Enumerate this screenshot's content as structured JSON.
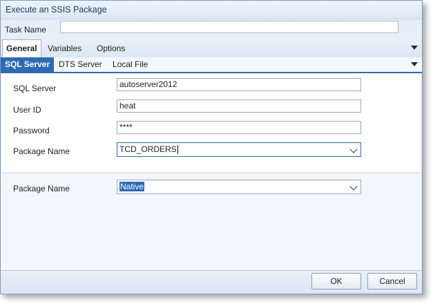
{
  "window": {
    "title": "Execute an SSIS Package"
  },
  "task": {
    "label": "Task Name",
    "value": ""
  },
  "tabs_primary": [
    {
      "label": "General",
      "active": true
    },
    {
      "label": "Variables",
      "active": false
    },
    {
      "label": "Options",
      "active": false
    }
  ],
  "tabs_secondary": [
    {
      "label": "SQL Server",
      "active": true
    },
    {
      "label": "DTS Server",
      "active": false
    },
    {
      "label": "Local File",
      "active": false
    }
  ],
  "form": {
    "sql_server": {
      "label": "SQL Server",
      "value": "autoserver2012"
    },
    "user_id": {
      "label": "User ID",
      "value": "heat"
    },
    "password": {
      "label": "Password",
      "value": "****"
    },
    "package_name": {
      "label": "Package Name",
      "value": "TCD_ORDERS"
    }
  },
  "lower": {
    "package_name": {
      "label": "Package Name",
      "value": "Native"
    }
  },
  "buttons": {
    "ok_label": "OK",
    "cancel_label": "Cancel"
  },
  "icons": {
    "overflow_primary": "chevron-down-icon",
    "overflow_secondary": "chevron-down-icon",
    "combo_dropdown": "chevron-down-icon"
  },
  "colors": {
    "accent": "#2e6ab3",
    "window_bg": "#e6eef7"
  }
}
